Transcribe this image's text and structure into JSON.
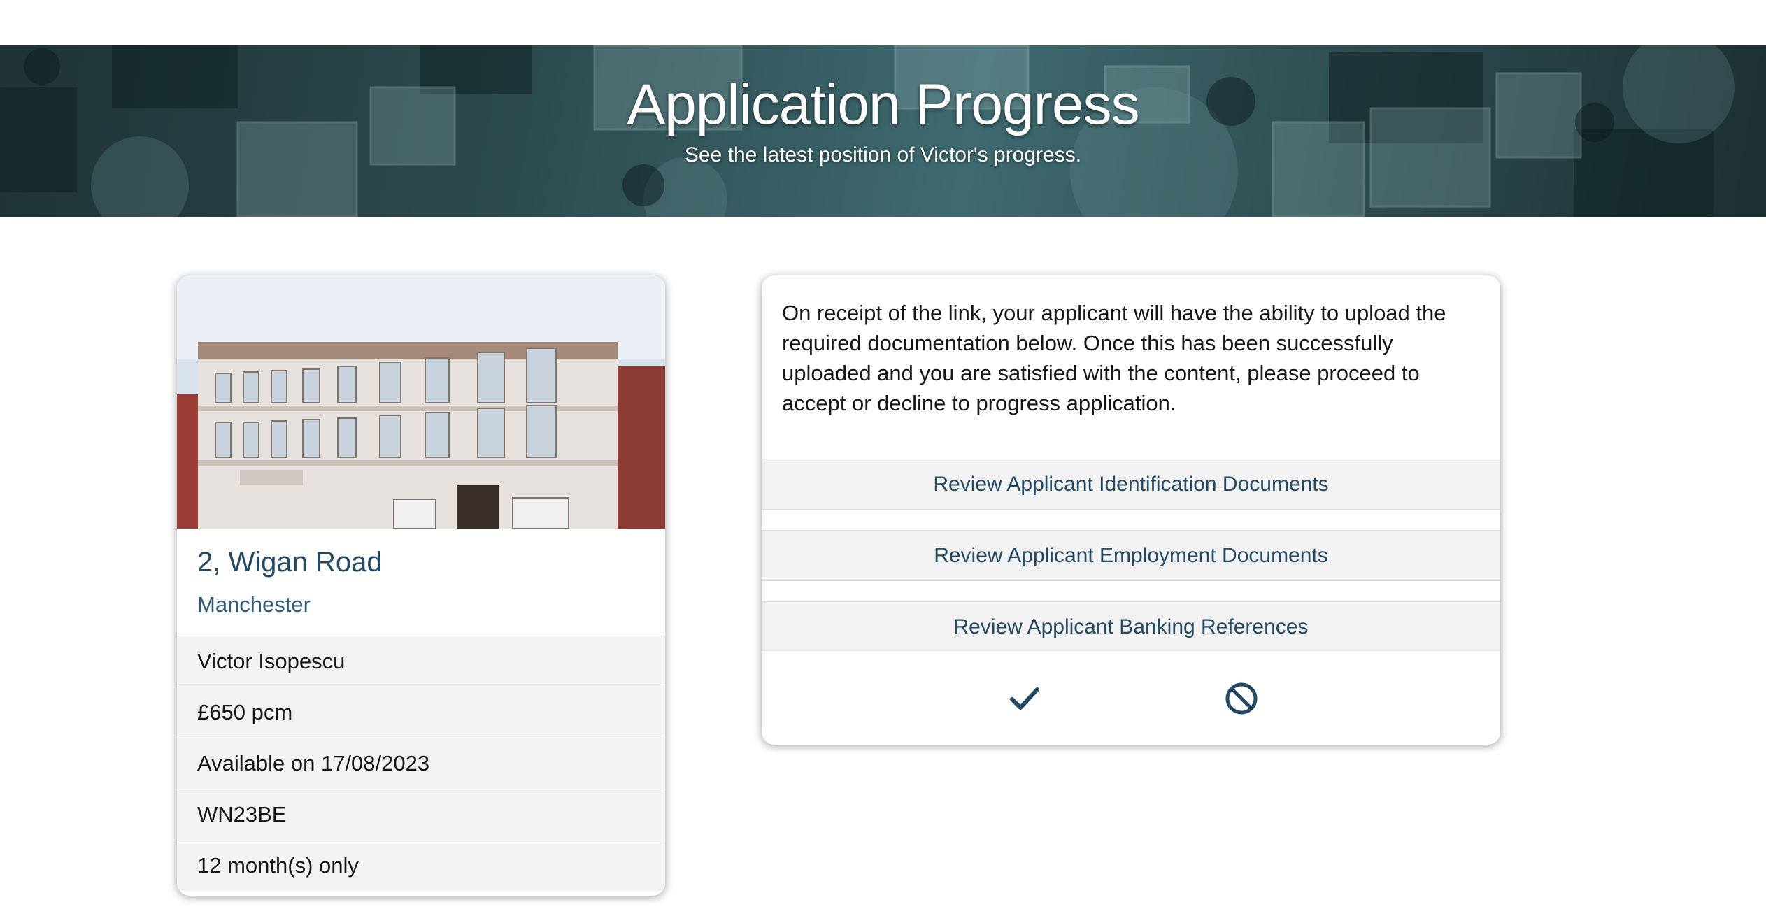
{
  "hero": {
    "title": "Application Progress",
    "subtitle": "See the latest position of Victor's progress."
  },
  "property": {
    "address_line1": "2, Wigan Road",
    "address_line2": "Manchester",
    "details": [
      "Victor Isopescu",
      "£650 pcm",
      "Available on 17/08/2023",
      "WN23BE",
      "12 month(s) only"
    ]
  },
  "info": {
    "text": "On receipt of the link, your applicant will have the ability to upload the required documentation below. Once this has been successfully uploaded and you are satisfied with the content, please proceed to accept or decline to progress application."
  },
  "reviews": [
    "Review Applicant Identification Documents",
    "Review Applicant Employment Documents",
    "Review Applicant Banking References"
  ],
  "icons": {
    "accept": "check-icon",
    "decline": "block-icon"
  },
  "colors": {
    "accent": "#234a62",
    "hero_bg": "#2c4b4f",
    "row_bg": "#f2f2f2"
  }
}
